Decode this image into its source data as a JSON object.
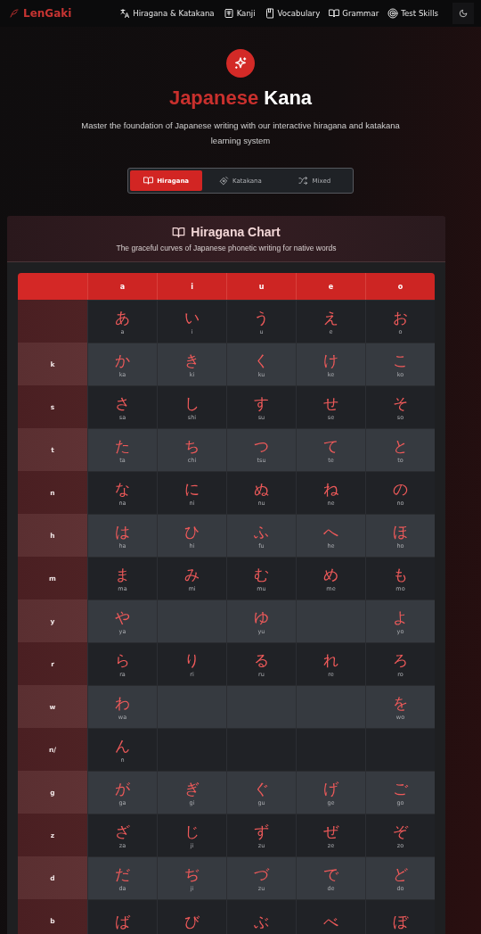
{
  "nav": {
    "logo": "LenGaki",
    "items": [
      {
        "label": "Hiragana & Katakana"
      },
      {
        "label": "Kanji"
      },
      {
        "label": "Vocabulary"
      },
      {
        "label": "Grammar"
      },
      {
        "label": "Test Skills"
      }
    ]
  },
  "hero": {
    "title_highlight": "Japanese",
    "title": "Kana",
    "subtitle": "Master the foundation of Japanese writing with our interactive hiragana and katakana learning system"
  },
  "tabs": [
    {
      "label": "Hiragana",
      "selected": true
    },
    {
      "label": "Katakana",
      "selected": false
    },
    {
      "label": "Mixed",
      "selected": false
    }
  ],
  "chart": {
    "title": "Hiragana Chart",
    "subtitle": "The graceful curves of Japanese phonetic writing for native words",
    "columns": [
      "a",
      "i",
      "u",
      "e",
      "o"
    ],
    "rows": [
      {
        "cells": [
          {
            "kana": "あ",
            "romaji": "a"
          },
          {
            "kana": "い",
            "romaji": "i"
          },
          {
            "kana": "う",
            "romaji": "u"
          },
          {
            "kana": "え",
            "romaji": "e"
          },
          {
            "kana": "お",
            "romaji": "o"
          }
        ]
      },
      {
        "label": "k",
        "cells": [
          {
            "kana": "か",
            "romaji": "ka"
          },
          {
            "kana": "き",
            "romaji": "ki"
          },
          {
            "kana": "く",
            "romaji": "ku"
          },
          {
            "kana": "け",
            "romaji": "ke"
          },
          {
            "kana": "こ",
            "romaji": "ko"
          }
        ]
      },
      {
        "label": "s",
        "cells": [
          {
            "kana": "さ",
            "romaji": "sa"
          },
          {
            "kana": "し",
            "romaji": "shi"
          },
          {
            "kana": "す",
            "romaji": "su"
          },
          {
            "kana": "せ",
            "romaji": "se"
          },
          {
            "kana": "そ",
            "romaji": "so"
          }
        ]
      },
      {
        "label": "t",
        "cells": [
          {
            "kana": "た",
            "romaji": "ta"
          },
          {
            "kana": "ち",
            "romaji": "chi"
          },
          {
            "kana": "つ",
            "romaji": "tsu"
          },
          {
            "kana": "て",
            "romaji": "te"
          },
          {
            "kana": "と",
            "romaji": "to"
          }
        ]
      },
      {
        "label": "n",
        "cells": [
          {
            "kana": "な",
            "romaji": "na"
          },
          {
            "kana": "に",
            "romaji": "ni"
          },
          {
            "kana": "ぬ",
            "romaji": "nu"
          },
          {
            "kana": "ね",
            "romaji": "ne"
          },
          {
            "kana": "の",
            "romaji": "no"
          }
        ]
      },
      {
        "label": "h",
        "cells": [
          {
            "kana": "は",
            "romaji": "ha"
          },
          {
            "kana": "ひ",
            "romaji": "hi"
          },
          {
            "kana": "ふ",
            "romaji": "fu"
          },
          {
            "kana": "へ",
            "romaji": "he"
          },
          {
            "kana": "ほ",
            "romaji": "ho"
          }
        ]
      },
      {
        "label": "m",
        "cells": [
          {
            "kana": "ま",
            "romaji": "ma"
          },
          {
            "kana": "み",
            "romaji": "mi"
          },
          {
            "kana": "む",
            "romaji": "mu"
          },
          {
            "kana": "め",
            "romaji": "me"
          },
          {
            "kana": "も",
            "romaji": "mo"
          }
        ]
      },
      {
        "label": "y",
        "cells": [
          {
            "kana": "や",
            "romaji": "ya"
          },
          null,
          {
            "kana": "ゆ",
            "romaji": "yu"
          },
          null,
          {
            "kana": "よ",
            "romaji": "yo"
          }
        ]
      },
      {
        "label": "r",
        "cells": [
          {
            "kana": "ら",
            "romaji": "ra"
          },
          {
            "kana": "り",
            "romaji": "ri"
          },
          {
            "kana": "る",
            "romaji": "ru"
          },
          {
            "kana": "れ",
            "romaji": "re"
          },
          {
            "kana": "ろ",
            "romaji": "ro"
          }
        ]
      },
      {
        "label": "w",
        "cells": [
          {
            "kana": "わ",
            "romaji": "wa"
          },
          null,
          null,
          null,
          {
            "kana": "を",
            "romaji": "wo"
          }
        ]
      },
      {
        "label": "n/",
        "cells": [
          {
            "kana": "ん",
            "romaji": "n"
          },
          null,
          null,
          null,
          null
        ]
      },
      {
        "label": "g",
        "cells": [
          {
            "kana": "が",
            "romaji": "ga"
          },
          {
            "kana": "ぎ",
            "romaji": "gi"
          },
          {
            "kana": "ぐ",
            "romaji": "gu"
          },
          {
            "kana": "げ",
            "romaji": "ge"
          },
          {
            "kana": "ご",
            "romaji": "go"
          }
        ]
      },
      {
        "label": "z",
        "cells": [
          {
            "kana": "ざ",
            "romaji": "za"
          },
          {
            "kana": "じ",
            "romaji": "ji"
          },
          {
            "kana": "ず",
            "romaji": "zu"
          },
          {
            "kana": "ぜ",
            "romaji": "ze"
          },
          {
            "kana": "ぞ",
            "romaji": "zo"
          }
        ]
      },
      {
        "label": "d",
        "cells": [
          {
            "kana": "だ",
            "romaji": "da"
          },
          {
            "kana": "ぢ",
            "romaji": "ji"
          },
          {
            "kana": "づ",
            "romaji": "zu"
          },
          {
            "kana": "で",
            "romaji": "de"
          },
          {
            "kana": "ど",
            "romaji": "do"
          }
        ]
      },
      {
        "label": "b",
        "cells": [
          {
            "kana": "ば"
          },
          {
            "kana": "び"
          },
          {
            "kana": "ぶ"
          },
          {
            "kana": "べ"
          },
          {
            "kana": "ぼ"
          }
        ]
      }
    ]
  }
}
